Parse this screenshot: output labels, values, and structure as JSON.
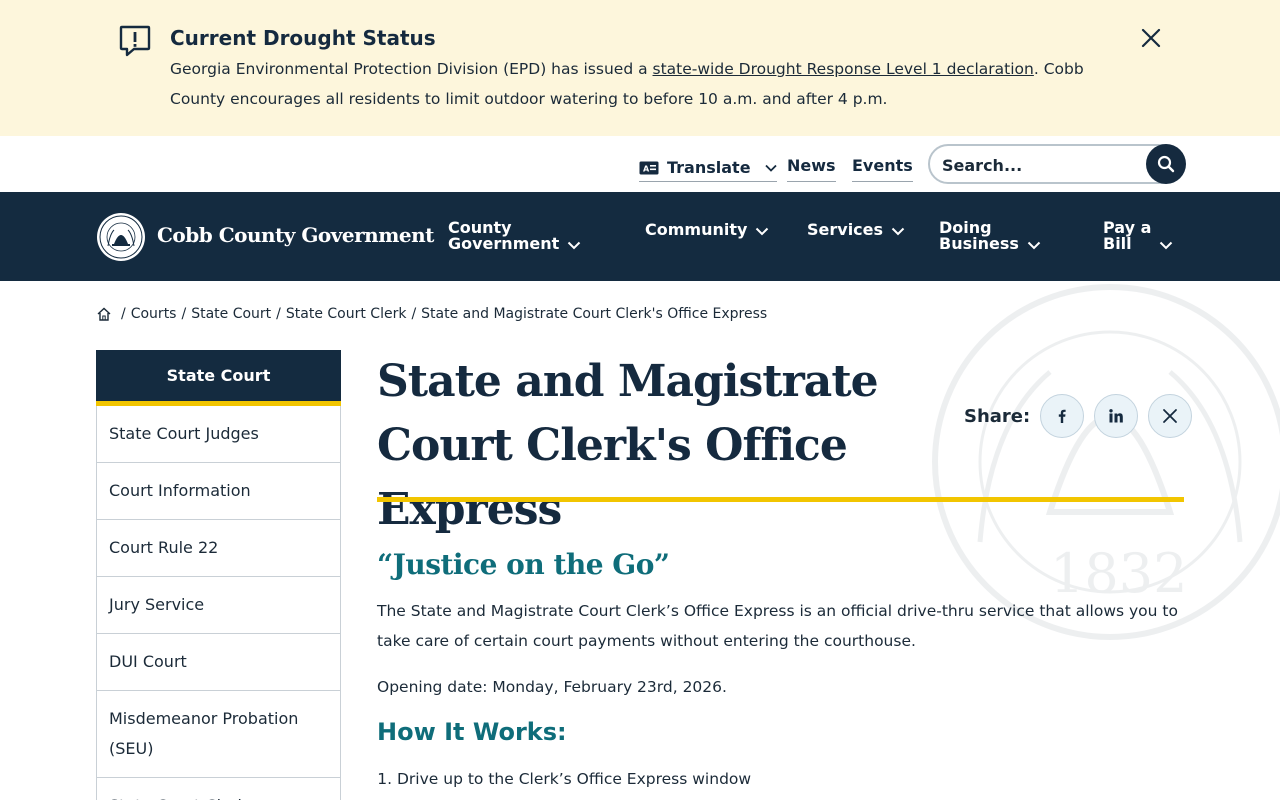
{
  "alert": {
    "title": "Current Drought Status",
    "text_before": "Georgia Environmental Protection Division (EPD) has issued a ",
    "link_text": "state-wide Drought Response Level 1 declaration",
    "text_after": ". Cobb County encourages all residents to limit outdoor watering to before 10 a.m. and after 4 p.m."
  },
  "utility": {
    "translate": "Translate",
    "news": "News",
    "events": "Events",
    "search_placeholder": "Search..."
  },
  "nav": {
    "logo": "Cobb County Government",
    "items": [
      {
        "line1": "County",
        "line2": "Government"
      },
      {
        "line1": "Community"
      },
      {
        "line1": "Services"
      },
      {
        "line1": "Doing",
        "line2": "Business"
      },
      {
        "line1": "Pay a",
        "line2": "Bill"
      }
    ]
  },
  "breadcrumb": [
    "Courts",
    "State Court",
    "State Court Clerk",
    "State and Magistrate Court Clerk's Office Express"
  ],
  "sidebar": {
    "heading": "State Court",
    "items": [
      "State Court Judges",
      "Court Information",
      "Court Rule 22",
      "Jury Service",
      "DUI Court",
      "Misdemeanor Probation (SEU)",
      "State Court Clerk"
    ]
  },
  "content": {
    "title": "State and Magistrate Court Clerk's Office Express",
    "share_label": "Share:",
    "section_heading": "“Justice on the Go”",
    "intro": "The State and Magistrate Court Clerk’s Office Express is an official drive-thru service that allows you to take care of certain court payments without entering the courthouse.",
    "opening": "Opening date:  Monday, February 23rd, 2026.",
    "how_heading": "How It Works:",
    "steps": [
      "Drive up to the Clerk’s Office Express window"
    ]
  },
  "watermark_year": "1832",
  "colors": {
    "navy": "#142b40",
    "gold": "#f2c500",
    "teal": "#0f6d7a",
    "banner": "#fdf6dc"
  }
}
